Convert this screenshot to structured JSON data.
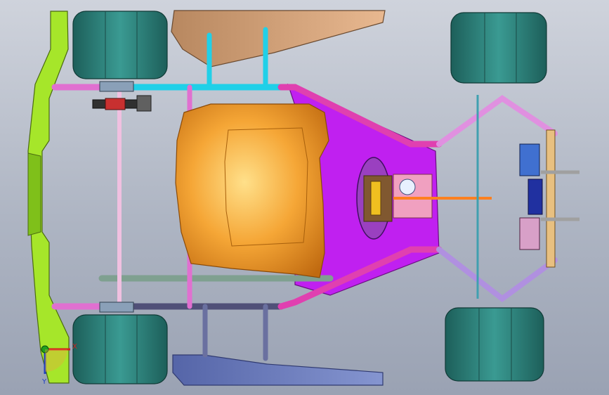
{
  "viewport": {
    "background_top": "#cfd3dc",
    "background_bottom": "#9aa2b3"
  },
  "triad": {
    "x_label": "X",
    "y_label": "Y",
    "x_color": "#d42020",
    "y_color": "#2040c0",
    "z_color": "#20a020"
  },
  "colors": {
    "tire": "#2f7f7a",
    "front_bumper": "#a6e62a",
    "seat": "#f0a030",
    "floor_pan": "#c020f0",
    "side_pod_top": "#d2a27a",
    "side_pod_bottom": "#6f7fc0",
    "frame_pink": "#e070d0",
    "frame_cyan": "#20d0e8",
    "frame_green": "#7fa090"
  }
}
